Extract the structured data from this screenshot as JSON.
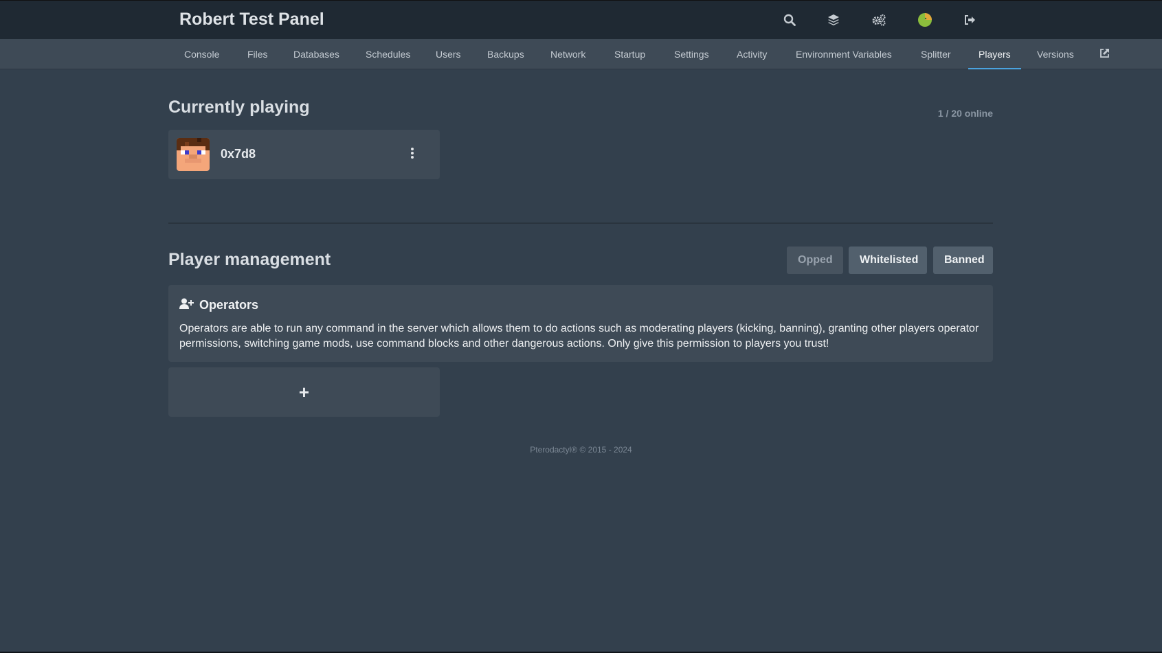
{
  "header": {
    "title": "Robert Test Panel",
    "icons": [
      "search-icon",
      "layers-icon",
      "cogs-icon",
      "avatar-icon",
      "sign-out-icon"
    ]
  },
  "tabs": [
    {
      "label": "Console"
    },
    {
      "label": "Files"
    },
    {
      "label": "Databases"
    },
    {
      "label": "Schedules"
    },
    {
      "label": "Users"
    },
    {
      "label": "Backups"
    },
    {
      "label": "Network"
    },
    {
      "label": "Startup"
    },
    {
      "label": "Settings"
    },
    {
      "label": "Activity"
    },
    {
      "label": "Environment Variables"
    },
    {
      "label": "Splitter"
    },
    {
      "label": "Players",
      "active": true
    },
    {
      "label": "Versions"
    }
  ],
  "playing": {
    "title": "Currently playing",
    "online": "1 / 20 online",
    "players": [
      {
        "name": "0x7d8"
      }
    ]
  },
  "management": {
    "title": "Player management",
    "filters": [
      {
        "label": "Opped",
        "active": true
      },
      {
        "label": "Whitelisted"
      },
      {
        "label": "Banned"
      }
    ],
    "operators": {
      "heading": "Operators",
      "description": "Operators are able to run any command in the server which allows them to do actions such as moderating players (kicking, banning), granting other players operator permissions, switching game mods, use command blocks and other dangerous actions. Only give this permission to players you trust!"
    },
    "add_label": "+"
  },
  "footer": "Pterodactyl® © 2015 - 2024",
  "colors": {
    "background": "#33404d",
    "topbar": "#1f2933",
    "card": "#3e4a56",
    "active_tab_underline": "#4aa3df"
  }
}
